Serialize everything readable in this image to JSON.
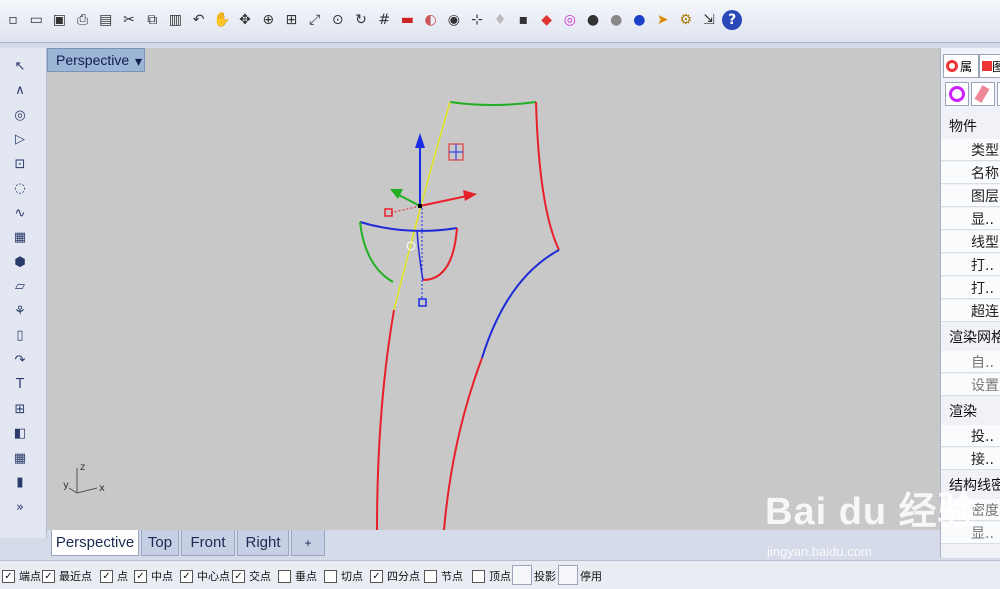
{
  "toolbar": {
    "icons": [
      "new-file-icon",
      "open-folder-icon",
      "save-icon",
      "print-icon",
      "import-icon",
      "cut-icon",
      "copy-icon",
      "paste-icon",
      "undo-icon",
      "pan-hand-icon",
      "rotate-view-icon",
      "zoom-icon",
      "zoom-window-icon",
      "zoom-extents-icon",
      "zoom-selected-icon",
      "rotate-icon",
      "grid-icon",
      "car-icon",
      "render-icon",
      "camera-icon",
      "osnap-icon",
      "light-bulb-icon",
      "lock-icon",
      "shaded-icon",
      "color-wheel-icon",
      "sphere-icon",
      "sphere-gray-icon",
      "sphere-blue-icon",
      "arrow-icon",
      "settings-gear-icon",
      "transform-icon",
      "help-icon"
    ]
  },
  "viewport": {
    "title": "Perspective",
    "axis": {
      "x": "x",
      "y": "y",
      "z": "z"
    }
  },
  "tabs": [
    {
      "label": "Perspective",
      "active": true
    },
    {
      "label": "Top",
      "active": false
    },
    {
      "label": "Front",
      "active": false
    },
    {
      "label": "Right",
      "active": false
    },
    {
      "label": "+",
      "active": false
    }
  ],
  "snaps": [
    {
      "label": "端点",
      "checked": true
    },
    {
      "label": "最近点",
      "checked": true
    },
    {
      "label": "点",
      "checked": true
    },
    {
      "label": "中点",
      "checked": true
    },
    {
      "label": "中心点",
      "checked": true
    },
    {
      "label": "交点",
      "checked": true
    },
    {
      "label": "垂点",
      "checked": false
    },
    {
      "label": "切点",
      "checked": false
    },
    {
      "label": "四分点",
      "checked": true
    },
    {
      "label": "节点",
      "checked": false
    },
    {
      "label": "顶点",
      "checked": false
    }
  ],
  "status_buttons": [
    {
      "label": "投影"
    },
    {
      "label": "停用"
    }
  ],
  "rightpanel": {
    "tab1": "属",
    "tab2": "图",
    "section_object": "物件",
    "object_rows": [
      "类型",
      "名称",
      "图层",
      "显..",
      "线型",
      "打..",
      "打..",
      "超连"
    ],
    "section_mesh": "渲染网格",
    "mesh_rows": [
      "自..",
      "设置"
    ],
    "section_render": "渲染",
    "render_rows": [
      "投..",
      "接.."
    ],
    "section_structure": "结构线密",
    "structure_rows": [
      "密度",
      "显.."
    ]
  },
  "watermark": {
    "logo": "Bai du 经验",
    "url": "jingyan.baidu.com"
  },
  "colors": {
    "viewport_bg": "#c8c8c8",
    "curve_red": "#e8202a",
    "curve_blue": "#1f2bd6",
    "curve_green": "#22b022",
    "curve_yellow": "#e6e620",
    "gumball_blue": "#1a2ce8"
  }
}
